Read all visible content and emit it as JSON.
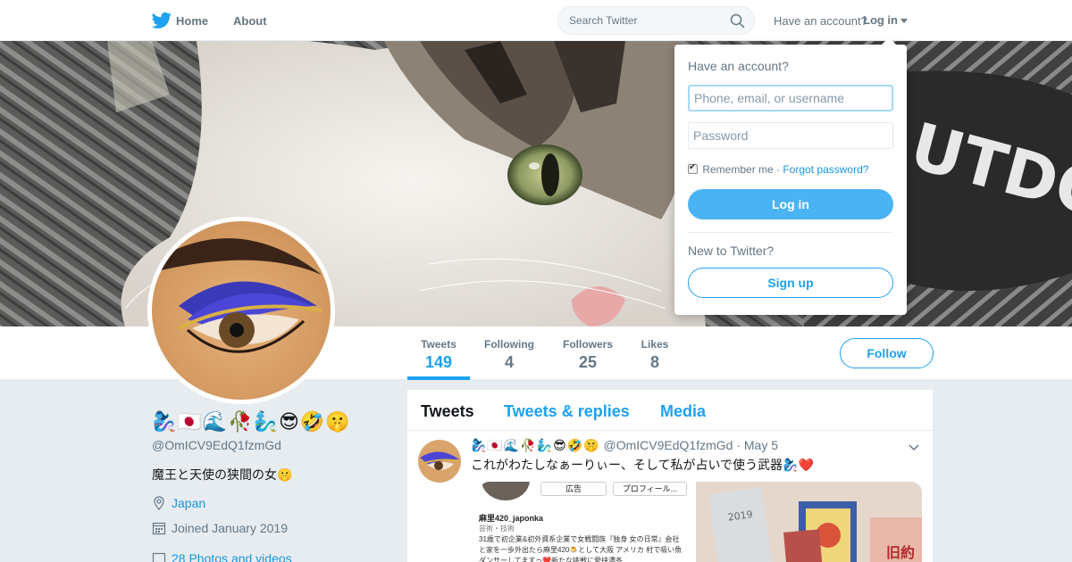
{
  "nav": {
    "home_label": "Home",
    "about_label": "About",
    "search_placeholder": "Search Twitter",
    "have_account": "Have an account?",
    "login_label": "Log in",
    "brand_color": "#1da1f2"
  },
  "profile": {
    "display_name": "🧞‍♀️🇯🇵🌊🥀🧞‍♂️😎🤣🤫",
    "handle": "@OmICV9EdQ1fzmGd",
    "bio": "魔王と天使の狭間の女🤫",
    "location": "Japan",
    "joined": "Joined January 2019",
    "photos": "28 Photos and videos"
  },
  "stats": [
    {
      "label": "Tweets",
      "value": "149",
      "active": true
    },
    {
      "label": "Following",
      "value": "4",
      "active": false
    },
    {
      "label": "Followers",
      "value": "25",
      "active": false
    },
    {
      "label": "Likes",
      "value": "8",
      "active": false
    }
  ],
  "follow_label": "Follow",
  "timeline": {
    "tabs": [
      "Tweets",
      "Tweets & replies",
      "Media"
    ],
    "tweet": {
      "name": "🧞‍♀️🇯🇵🌊🥀🧞‍♂️😎🤣🤫",
      "handle": "@OmICV9EdQ1fzmGd",
      "date": "May 5",
      "text": "これがわたしなぁーりぃー、そして私が占いで使う武器🧞‍♀️❤️",
      "media1": {
        "btn_ad": "広告",
        "btn_profile": "プロフィール...",
        "name": "麻里420_japonka",
        "sub": "芸術・技術",
        "body": "31歳で初企業&初外資系企業で女戦闘族『独身 女の日常』会社と家を一歩外出たら麻里420🍮として大阪 アメリカ 村で吸い魚ダンサーしてますっ❤️新たな挑戦に愛挟濃冬..."
      }
    }
  },
  "login": {
    "title": "Have an account?",
    "username_placeholder": "Phone, email, or username",
    "password_placeholder": "Password",
    "remember": "Remember me",
    "separator": " · ",
    "forgot": "Forgot password?",
    "login_button": "Log in",
    "new_to": "New to Twitter?",
    "signup_button": "Sign up"
  }
}
